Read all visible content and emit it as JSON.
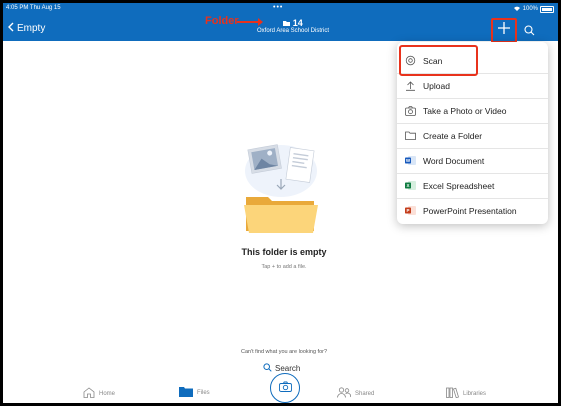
{
  "status_bar": {
    "time": "4:05 PM  Thu Aug 15",
    "dots": "•••",
    "battery": "100%"
  },
  "header": {
    "back_label": "Empty",
    "title": "14",
    "subtitle": "Oxford Area School District",
    "annotation": "Folder"
  },
  "menu": {
    "items": [
      {
        "label": "Scan",
        "icon": "scan-icon"
      },
      {
        "label": "Upload",
        "icon": "upload-icon"
      },
      {
        "label": "Take a Photo or Video",
        "icon": "camera-icon"
      },
      {
        "label": "Create a Folder",
        "icon": "folder-icon"
      },
      {
        "label": "Word Document",
        "icon": "word-icon"
      },
      {
        "label": "Excel Spreadsheet",
        "icon": "excel-icon"
      },
      {
        "label": "PowerPoint Presentation",
        "icon": "powerpoint-icon"
      }
    ]
  },
  "empty_state": {
    "title": "This folder is empty",
    "hint": "Tap + to add a file."
  },
  "bottom": {
    "cant_find": "Can't find what you are looking for?",
    "search_label": "Search"
  },
  "tabs": [
    {
      "label": "Home"
    },
    {
      "label": "Files"
    },
    {
      "label": "Shared"
    },
    {
      "label": "Libraries"
    }
  ],
  "colors": {
    "brand": "#0f6cbd",
    "annotation": "#e8321c"
  }
}
